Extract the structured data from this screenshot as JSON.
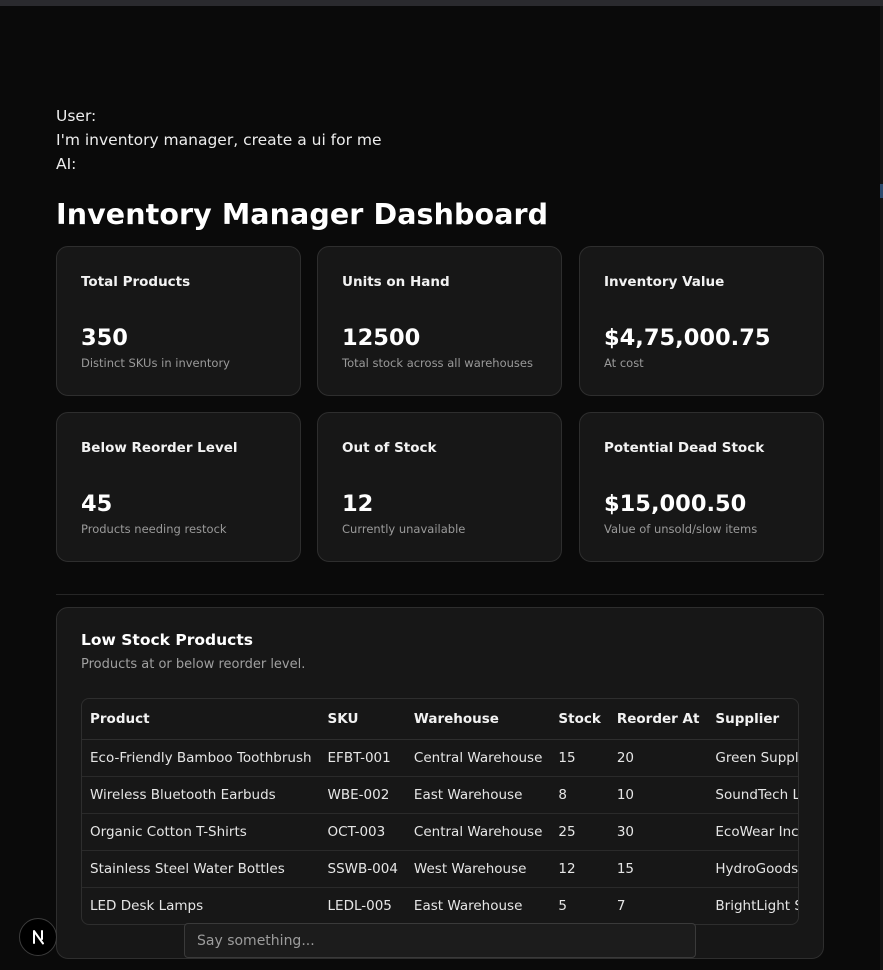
{
  "chat": {
    "user_label": "User:",
    "user_message": "I'm inventory manager, create a ui for me",
    "ai_label": "AI:"
  },
  "dashboard": {
    "title": "Inventory Manager Dashboard",
    "cards": [
      {
        "label": "Total Products",
        "value": "350",
        "sub": "Distinct SKUs in inventory"
      },
      {
        "label": "Units on Hand",
        "value": "12500",
        "sub": "Total stock across all warehouses"
      },
      {
        "label": "Inventory Value",
        "value": "$4,75,000.75",
        "sub": "At cost"
      },
      {
        "label": "Below Reorder Level",
        "value": "45",
        "sub": "Products needing restock"
      },
      {
        "label": "Out of Stock",
        "value": "12",
        "sub": "Currently unavailable"
      },
      {
        "label": "Potential Dead Stock",
        "value": "$15,000.50",
        "sub": "Value of unsold/slow items"
      }
    ]
  },
  "low_stock": {
    "title": "Low Stock Products",
    "subtitle": "Products at or below reorder level.",
    "columns": [
      "Product",
      "SKU",
      "Warehouse",
      "Stock",
      "Reorder At",
      "Supplier"
    ],
    "rows": [
      [
        "Eco-Friendly Bamboo Toothbrush",
        "EFBT-001",
        "Central Warehouse",
        "15",
        "20",
        "Green Supplies Co."
      ],
      [
        "Wireless Bluetooth Earbuds",
        "WBE-002",
        "East Warehouse",
        "8",
        "10",
        "SoundTech Ltd."
      ],
      [
        "Organic Cotton T-Shirts",
        "OCT-003",
        "Central Warehouse",
        "25",
        "30",
        "EcoWear Inc."
      ],
      [
        "Stainless Steel Water Bottles",
        "SSWB-004",
        "West Warehouse",
        "12",
        "15",
        "HydroGoods LLC"
      ],
      [
        "LED Desk Lamps",
        "LEDL-005",
        "East Warehouse",
        "5",
        "7",
        "BrightLight Suppliers"
      ]
    ]
  },
  "input": {
    "placeholder": "Say something..."
  },
  "badge": {
    "letter": "N",
    "icon": "nextjs-logo-icon"
  }
}
